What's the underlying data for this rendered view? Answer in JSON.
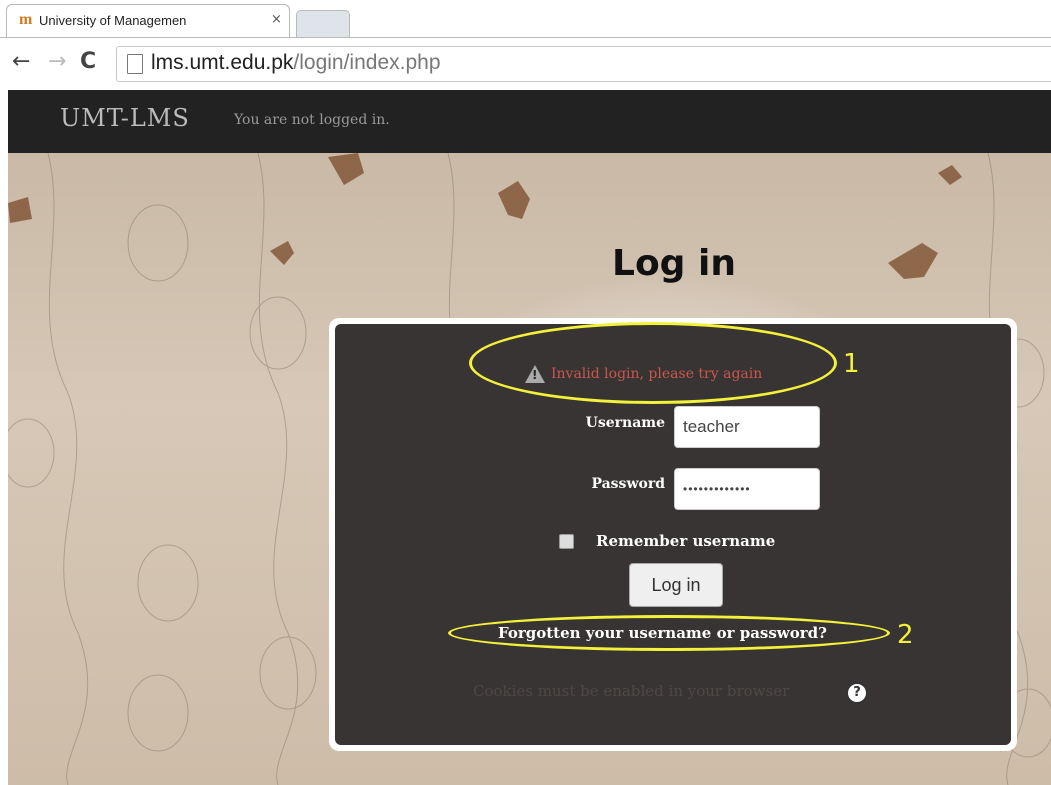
{
  "browser": {
    "tab_title": "University of Managemen",
    "tab_close": "×",
    "url_domain": "lms.umt.edu.pk",
    "url_path": "/login/index.php",
    "back_icon": "←",
    "forward_icon": "→",
    "reload_icon": "C"
  },
  "header": {
    "brand": "UMT-LMS",
    "login_status": "You are not logged in."
  },
  "login": {
    "heading": "Log in",
    "error_message": "Invalid login, please try again",
    "username_label": "Username",
    "username_value": "teacher",
    "password_label": "Password",
    "password_value": "•••••••••••••",
    "remember_label": "Remember username",
    "remember_checked": false,
    "login_button": "Log in",
    "forgot_link": "Forgotten your username or password?",
    "cookies_notice": "Cookies must be enabled in your browser",
    "help_icon": "?"
  },
  "annotations": {
    "label_1": "1",
    "label_2": "2",
    "color": "#f3f13a"
  },
  "colors": {
    "navbar": "#222222",
    "error_text": "#c9574c",
    "panel_bg": "#282523"
  }
}
